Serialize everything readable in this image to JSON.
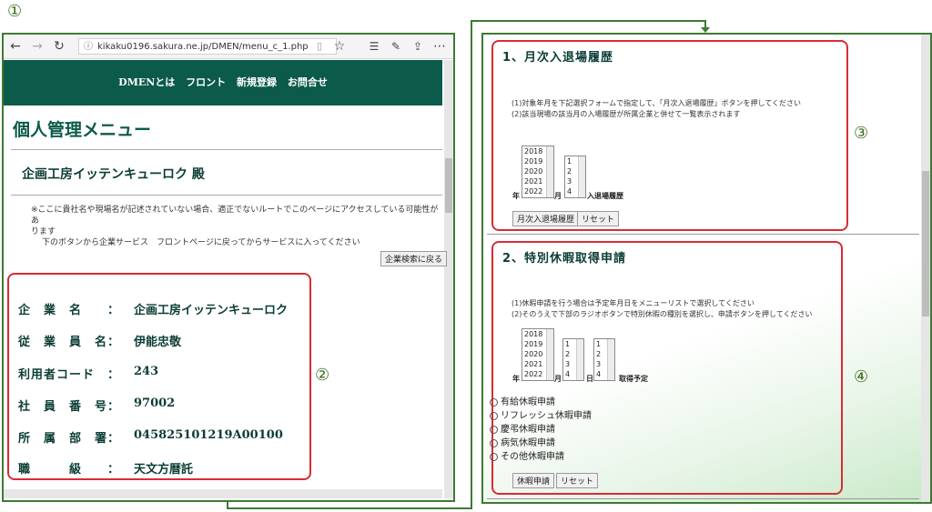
{
  "labels": {
    "one": "①",
    "two": "②",
    "three": "③",
    "four": "④"
  },
  "browser": {
    "url": "kikaku0196.sakura.ne.jp/DMEN/menu_c_1.php",
    "icons": [
      "back-arrow-icon",
      "forward-arrow-icon",
      "refresh-icon",
      "info-icon",
      "reading-view-icon",
      "star-icon",
      "favorites-icon",
      "pen-icon",
      "share-icon",
      "more-icon"
    ]
  },
  "nav": {
    "items": [
      "DMENとは",
      "フロント",
      "新規登録",
      "お問合せ"
    ]
  },
  "page": {
    "title": "個人管理メニュー",
    "company_heading": "企画工房イッテンキューロク 殿",
    "notice_line1": "※ここに貴社名や現場名が記述されていない場合、適正でないルートでこのページにアクセスしている可能性があ",
    "notice_line2": "ります",
    "notice_line3": "下のボタンから企業サービス　フロントページに戻ってからサービスに入ってください",
    "back_button": "企業検索に戻る"
  },
  "profile": [
    {
      "label": "企　業　名　　：",
      "value": "企画工房イッテンキューロク"
    },
    {
      "label": "従　業　員　名：",
      "value": "伊能忠敬"
    },
    {
      "label": "利用者コード　：",
      "value": "243"
    },
    {
      "label": "社　員　番　号：",
      "value": "97002"
    },
    {
      "label": "所　属　部　署：",
      "value": "045825101219A00100"
    },
    {
      "label": "職　　　級　　：",
      "value": "天文方暦託"
    }
  ],
  "section1": {
    "title": "1、月次入退場履歴",
    "line1": "(1)対象年月を下記選択フォームで指定して、「月次入退場履歴」ボタンを押してください",
    "line2": "(2)該当現場の該当月の入場履歴が所属企業と併せて一覧表示されます",
    "years": [
      "2018",
      "2019",
      "2020",
      "2021",
      "2022"
    ],
    "months": [
      "1",
      "2",
      "3",
      "4"
    ],
    "year_suffix": "年",
    "month_suffix": "月",
    "list_suffix": "入退場履歴",
    "submit": "月次入退場履歴",
    "reset": "リセット"
  },
  "section2": {
    "title": "2、特別休暇取得申請",
    "line1": "(1)休暇申請を行う場合は予定年月日をメニューリストで選択してください",
    "line2": "(2)そのうえで下部のラジオボタンで特別休暇の種別を選択し、申請ボタンを押してください",
    "years": [
      "2018",
      "2019",
      "2020",
      "2021",
      "2022"
    ],
    "months": [
      "1",
      "2",
      "3",
      "4"
    ],
    "days": [
      "1",
      "2",
      "3",
      "4"
    ],
    "year_suffix": "年",
    "month_suffix": "月",
    "day_suffix": "日",
    "plan_suffix": "取得予定",
    "leave_types": [
      "有給休暇申請",
      "リフレッシュ休暇申請",
      "慶弔休暇申請",
      "病気休暇申請",
      "その他休暇申請"
    ],
    "submit": "休暇申請",
    "reset": "リセット"
  },
  "colors": {
    "frame": "#3e7a33",
    "header": "#0b5a4a",
    "highlight": "#d92b36"
  }
}
